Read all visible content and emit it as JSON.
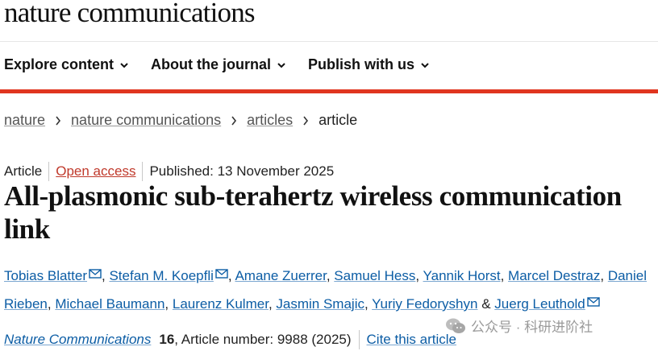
{
  "header": {
    "brand": "nature communications",
    "nav": [
      "Explore content",
      "About the journal",
      "Publish with us"
    ]
  },
  "breadcrumb": {
    "links": [
      "nature",
      "nature communications",
      "articles"
    ],
    "current": "article"
  },
  "article": {
    "type": "Article",
    "access": "Open access",
    "published": "Published: 13 November 2025",
    "title": "All-plasmonic sub-terahertz wireless communication link",
    "authors": [
      "Tobias Blatter",
      "Stefan M. Koepfli",
      "Amane Zuerrer",
      "Samuel Hess",
      "Yannik Horst",
      "Marcel Destraz",
      "Daniel Rieben",
      "Michael Baumann",
      "Laurenz Kulmer",
      "Jasmin Smajic",
      "Yuriy Fedoryshyn",
      "Juerg Leuthold"
    ],
    "conjunction": "&",
    "journal": "Nature Communications",
    "volume": "16",
    "article_number": ", Article number: 9988 (2025)",
    "cite": "Cite this article"
  },
  "watermark": "公众号 · 科研进阶社",
  "colors": {
    "accent_red": "#e0351f",
    "link_blue": "#0c5da5",
    "open_access": "#c0392b"
  }
}
